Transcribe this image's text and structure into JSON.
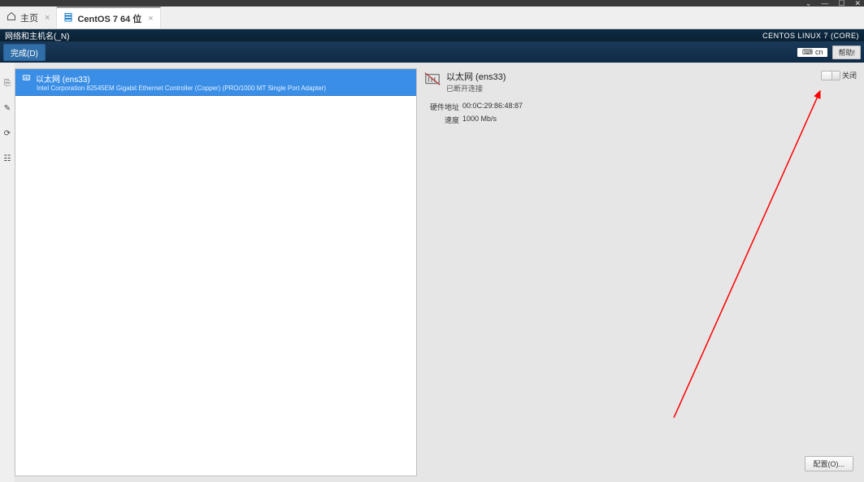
{
  "window": {
    "controls": {
      "dropdown": "⌄",
      "minimize": "—",
      "maximize": "☐",
      "close": "✕"
    }
  },
  "tabs": {
    "home": {
      "label": "主页"
    },
    "vm": {
      "label": "CentOS 7 64 位"
    }
  },
  "header": {
    "title": "网络和主机名(_N)",
    "brand": "CENTOS LINUX 7 (CORE)"
  },
  "subband": {
    "done_label": "完成(D)",
    "ime_label": "cn",
    "help_label": "帮助!"
  },
  "left_gutter": {
    "g1": "⎘",
    "g2": "✎",
    "g3": "⟳",
    "g4": "☷"
  },
  "nic_list": {
    "item1": {
      "name": "以太网  (ens33)",
      "desc": "Intel Corporation 82545EM Gigabit Ethernet Controller (Copper) (PRO/1000 MT Single Port Adapter)"
    }
  },
  "detail": {
    "title": "以太网  (ens33)",
    "status": "已断开连接",
    "hw_label": "硬件地址",
    "hw_value": "00:0C:29:86:48:87",
    "speed_label": "速度",
    "speed_value": "1000 Mb/s"
  },
  "toggle": {
    "label": "关闭"
  },
  "config_button": {
    "label": "配置(O)..."
  },
  "annotation": {
    "arrow_color": "#ff0000"
  }
}
